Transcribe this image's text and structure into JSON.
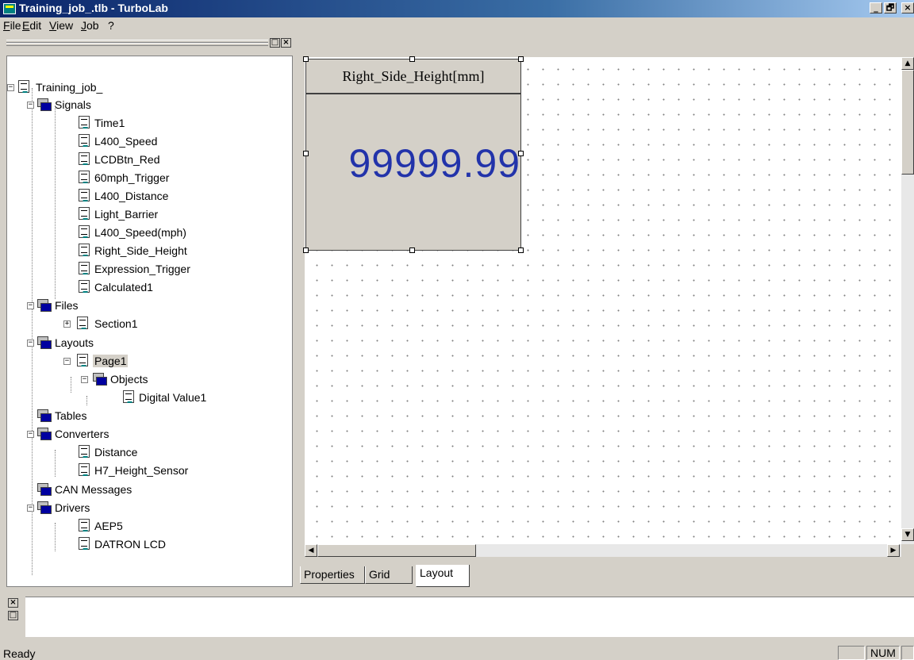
{
  "window": {
    "title": "Training_job_.tlb - TurboLab",
    "minimize": "_",
    "maximize": "🗗",
    "close": "×"
  },
  "menu": [
    "File",
    "Edit",
    "View",
    "Job",
    "?"
  ],
  "tree": {
    "root": "Training_job_",
    "signals": {
      "label": "Signals",
      "items": [
        "Time1",
        "L400_Speed",
        "LCDBtn_Red",
        "60mph_Trigger",
        "L400_Distance",
        "Light_Barrier",
        "L400_Speed(mph)",
        "Right_Side_Height",
        "Expression_Trigger",
        "Calculated1"
      ]
    },
    "files": {
      "label": "Files",
      "items": [
        "Section1"
      ]
    },
    "layouts": {
      "label": "Layouts",
      "page": "Page1",
      "objects": "Objects",
      "object_items": [
        "Digital Value1"
      ]
    },
    "tables": "Tables",
    "converters": {
      "label": "Converters",
      "items": [
        "Distance",
        "H7_Height_Sensor"
      ]
    },
    "can_messages": "CAN Messages",
    "drivers": {
      "label": "Drivers",
      "items": [
        "AEP5",
        "DATRON LCD"
      ]
    }
  },
  "digital_value": {
    "header": "Right_Side_Height[mm]",
    "value": "99999.99",
    "value_color": "#2233aa"
  },
  "tabs": [
    "Properties",
    "Grid",
    "Layout"
  ],
  "active_tab": "Layout",
  "status": {
    "text": "Ready",
    "num": "NUM"
  }
}
